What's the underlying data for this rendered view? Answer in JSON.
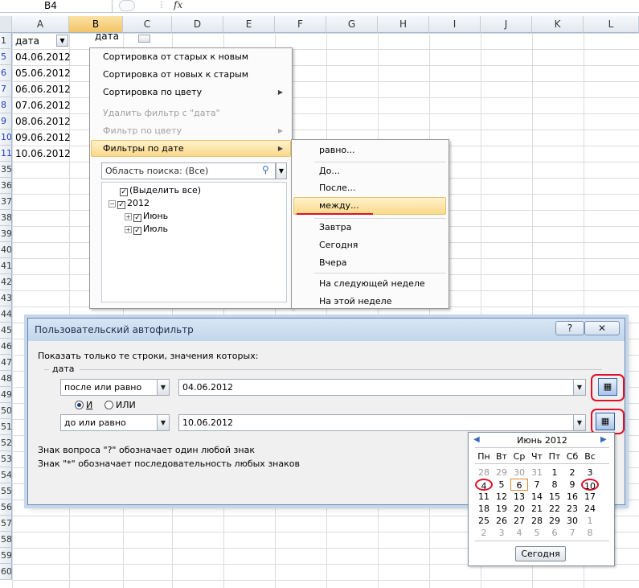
{
  "formula_bar": {
    "name_box": "B4",
    "fx": "fx"
  },
  "columns": [
    "A",
    "B",
    "C",
    "D",
    "E",
    "F",
    "G",
    "H",
    "I",
    "J",
    "K",
    "L"
  ],
  "rows": [
    "1",
    "5",
    "6",
    "7",
    "8",
    "9",
    "10",
    "11",
    "35",
    "36",
    "37",
    "38",
    "39",
    "40",
    "41",
    "42",
    "43",
    "44",
    "45",
    "46",
    "47",
    "48",
    "49",
    "50",
    "51",
    "52",
    "53",
    "54",
    "55",
    "56",
    "57",
    "58",
    "59",
    "60"
  ],
  "colA": {
    "header": "дата",
    "dates": [
      "04.06.2012",
      "05.06.2012",
      "06.06.2012",
      "07.06.2012",
      "08.06.2012",
      "09.06.2012",
      "10.06.2012"
    ]
  },
  "colB": {
    "header": "дата"
  },
  "menu": {
    "items": [
      "Сортировка от старых к новым",
      "Сортировка от новых к старым",
      "Сортировка по цвету",
      "Удалить фильтр с \"дата\"",
      "Фильтр по цвету",
      "Фильтры по дате"
    ],
    "search_placeholder": "Область поиска: (Все)",
    "tree": [
      "(Выделить все)",
      "2012",
      "Июнь",
      "Июль"
    ]
  },
  "submenu": {
    "items": [
      "равно...",
      "До...",
      "После...",
      "между...",
      "Завтра",
      "Сегодня",
      "Вчера",
      "На следующей неделе",
      "На этой неделе"
    ]
  },
  "dialog": {
    "title": "Пользовательский автофильтр",
    "help": "?",
    "close": "✕",
    "prompt": "Показать только те строки, значения которых:",
    "field": "дата",
    "cond1_op": "после или равно",
    "cond1_val": "04.06.2012",
    "and_label": "И",
    "or_label": "ИЛИ",
    "cond2_op": "до или равно",
    "cond2_val": "10.06.2012",
    "hint1": "Знак вопроса \"?\" обозначает один любой знак",
    "hint2": "Знак \"*\" обозначает последовательность любых знаков"
  },
  "calendar": {
    "month": "Июнь 2012",
    "weekdays": [
      "Пн",
      "Вт",
      "Ср",
      "Чт",
      "Пт",
      "Сб",
      "Вс"
    ],
    "weeks": [
      [
        "28",
        "29",
        "30",
        "31",
        "1",
        "2",
        "3"
      ],
      [
        "4",
        "5",
        "6",
        "7",
        "8",
        "9",
        "10"
      ],
      [
        "11",
        "12",
        "13",
        "14",
        "15",
        "16",
        "17"
      ],
      [
        "18",
        "19",
        "20",
        "21",
        "22",
        "23",
        "24"
      ],
      [
        "25",
        "26",
        "27",
        "28",
        "29",
        "30",
        "1"
      ],
      [
        "2",
        "3",
        "4",
        "5",
        "6",
        "7",
        "8"
      ]
    ],
    "today_button": "Сегодня"
  },
  "colors": {
    "accent_red": "#e0102a",
    "highlight": "#fbd98a",
    "link_blue": "#1a3fc4"
  }
}
